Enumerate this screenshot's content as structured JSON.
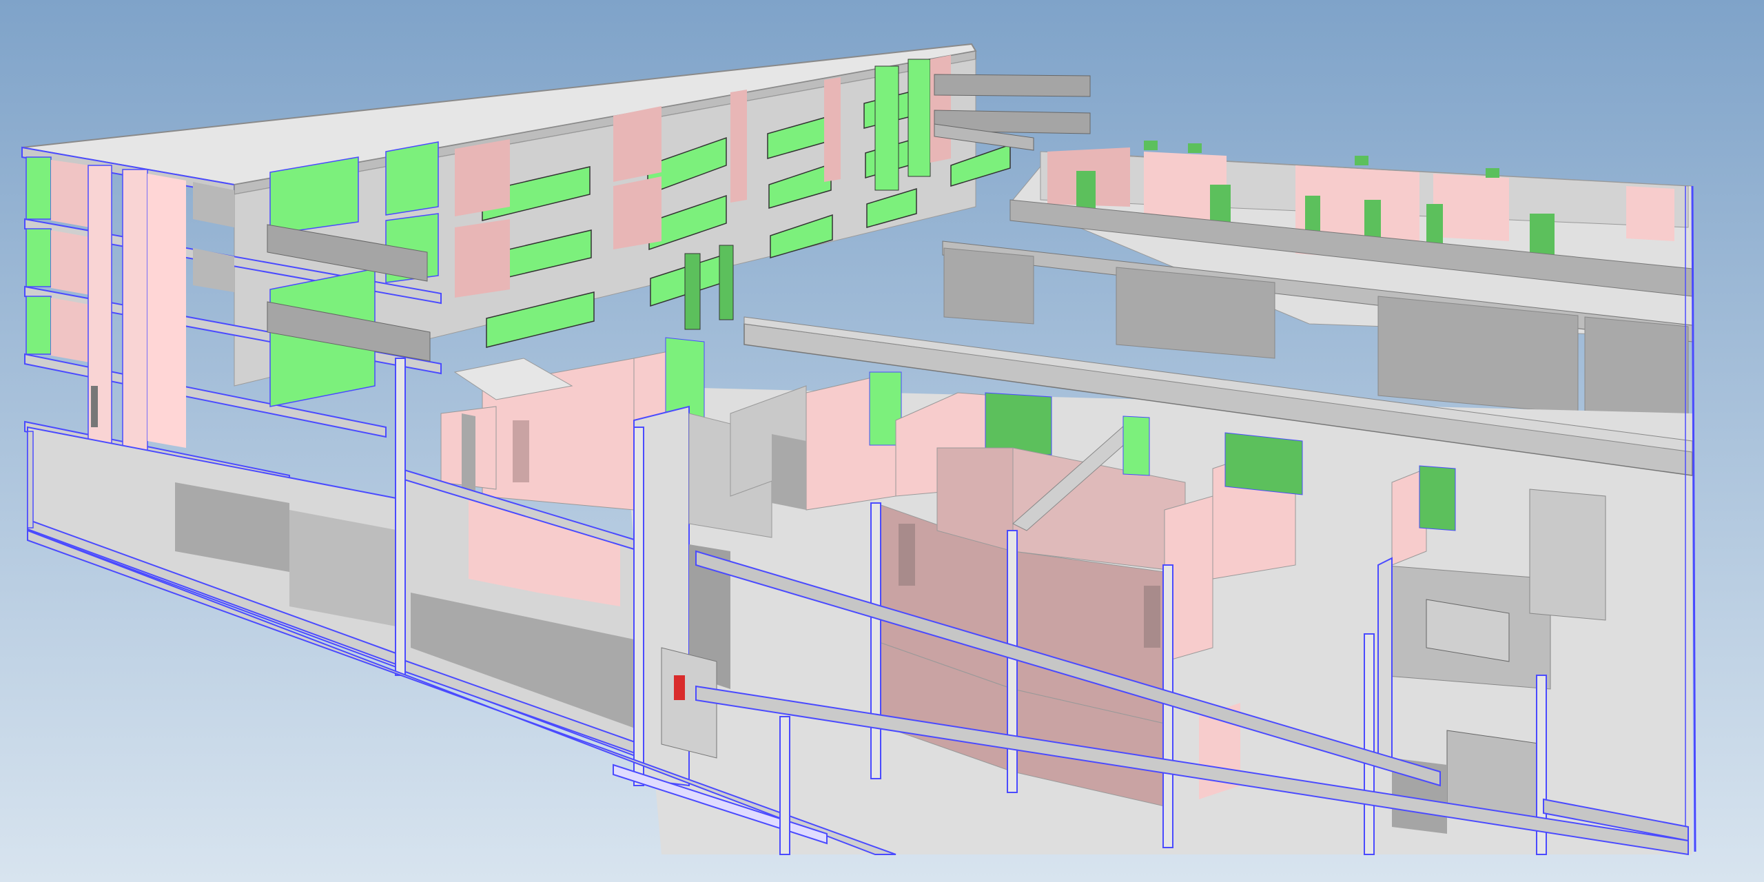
{
  "viewer": {
    "colors": {
      "sky_top": "#7fa3c9",
      "sky_bottom": "#d8e4ef",
      "slab": "#d9d9d9",
      "slab_top": "#e4e4e4",
      "wall_gray": "#a8a8a8",
      "wall_gray_light": "#c8c8c8",
      "wall_dark": "#8e8e8e",
      "wall_pink": "#f7cccc",
      "wall_pink_shade": "#c9a3a3",
      "panel_green": "#7cf07c",
      "panel_green_dark": "#5cc05c",
      "edge_blue": "#4a4aff",
      "highlight_red": "#d92b2b"
    },
    "elements": {
      "slab": "floor-slab",
      "wall": "wall",
      "opening": "door-opening",
      "panel": "facade-panel",
      "column": "column",
      "selected": "selected-element"
    }
  }
}
